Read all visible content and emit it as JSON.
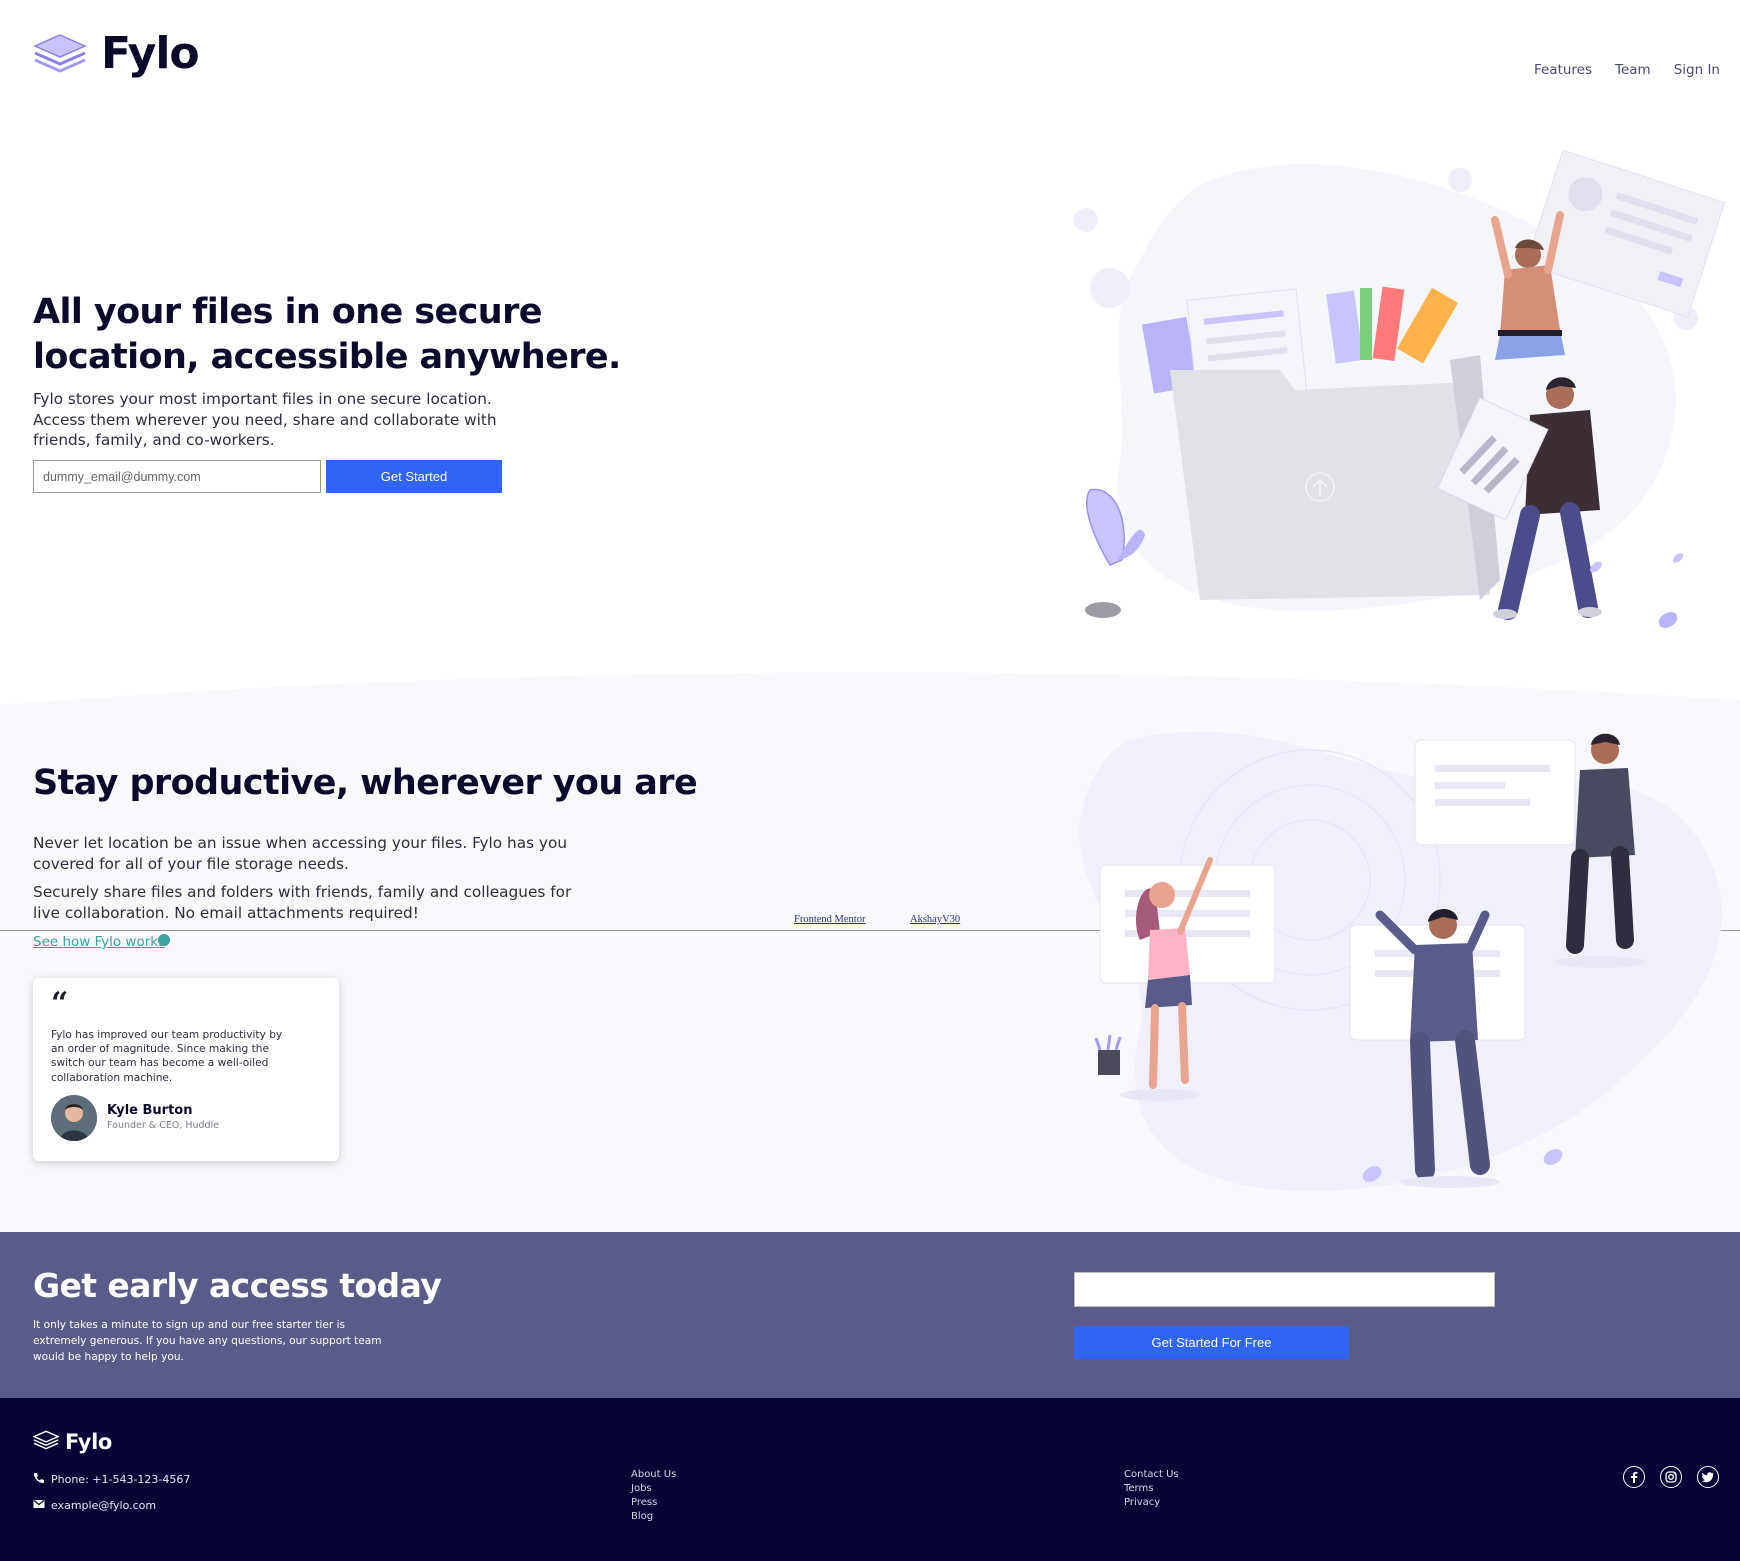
{
  "header": {
    "logo_text": "Fylo",
    "nav": [
      "Features",
      "Team",
      "Sign In"
    ]
  },
  "hero": {
    "title": "All your files in one secure location, accessible anywhere.",
    "description": "Fylo stores your most important files in one secure location. Access them wherever you need, share and collaborate with friends, family, and co-workers.",
    "email_placeholder": "dummy_email@dummy.com",
    "cta_label": "Get Started"
  },
  "productive": {
    "title": "Stay productive, wherever you are",
    "paragraph1": "Never let location be an issue when accessing your files. Fylo has you covered for all of your file storage needs.",
    "paragraph2": "Securely share files and folders with friends, family and colleagues for live collaboration. No email attachments required!",
    "link_label": "See how Fylo works"
  },
  "attribution": {
    "left": "Frontend Mentor",
    "right": "AkshayV30"
  },
  "testimonial": {
    "quote_mark": "“",
    "text": "Fylo has improved our team productivity by an order of magnitude. Since making the switch our team has become a well-oiled collaboration machine.",
    "name": "Kyle Burton",
    "role": "Founder & CEO, Huddle"
  },
  "early_access": {
    "title": "Get early access today",
    "description": "It only takes a minute to sign up and our free starter tier is extremely generous. If you have any questions, our support team would be happy to help you.",
    "email_value": "",
    "cta_label": "Get Started For Free"
  },
  "footer": {
    "logo_text": "Fylo",
    "phone": "Phone: +1-543-123-4567",
    "email": "example@fylo.com",
    "links_col1": [
      "About Us",
      "Jobs",
      "Press",
      "Blog"
    ],
    "links_col2": [
      "Contact Us",
      "Terms",
      "Privacy"
    ],
    "social_icons": [
      "facebook-icon",
      "instagram-icon",
      "twitter-icon"
    ]
  },
  "colors": {
    "accent_blue": "#3064f5",
    "early_access_bg": "#5a5b88",
    "footer_bg": "#060335",
    "section_bg": "#f8f8fd",
    "link_teal": "#3aa5a0"
  }
}
